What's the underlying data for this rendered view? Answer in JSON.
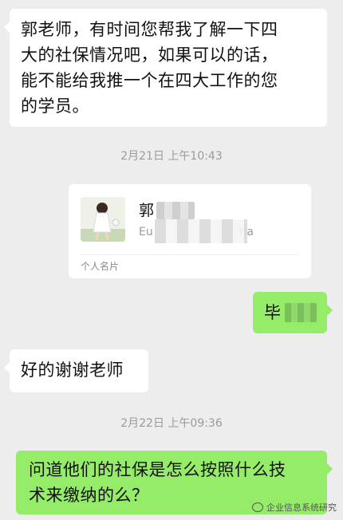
{
  "messages": {
    "m1_text": "郭老师，有时间您帮我了解一下四大的社保情况吧，如果可以的话，能不能给我推一个在四大工作的您的学员。",
    "m1_line1": "郭老师，有时间您帮我了解一下四",
    "m1_line2": "大的社保情况吧，如果可以的话，",
    "m1_line3": "能不能给我推一个在四大工作的您",
    "m1_line4": "的学员。",
    "time1": "2月21日 上午10:43",
    "card": {
      "name_visible": "郭",
      "sub_visible": "Eu",
      "sub_tail": "ria",
      "type_label": "个人名片"
    },
    "m2_visible": "毕",
    "m3_text": "好的谢谢老师",
    "time2": "2月22日 上午09:36",
    "m4_line1": "问道他们的社保是怎么按照什么技",
    "m4_line2": "术来缴纳的么？"
  },
  "watermark": "企业信息系统研究",
  "colors": {
    "background": "#ededed",
    "incoming_bubble": "#ffffff",
    "outgoing_bubble": "#95ec69",
    "timestamp": "#9b9b9b"
  }
}
